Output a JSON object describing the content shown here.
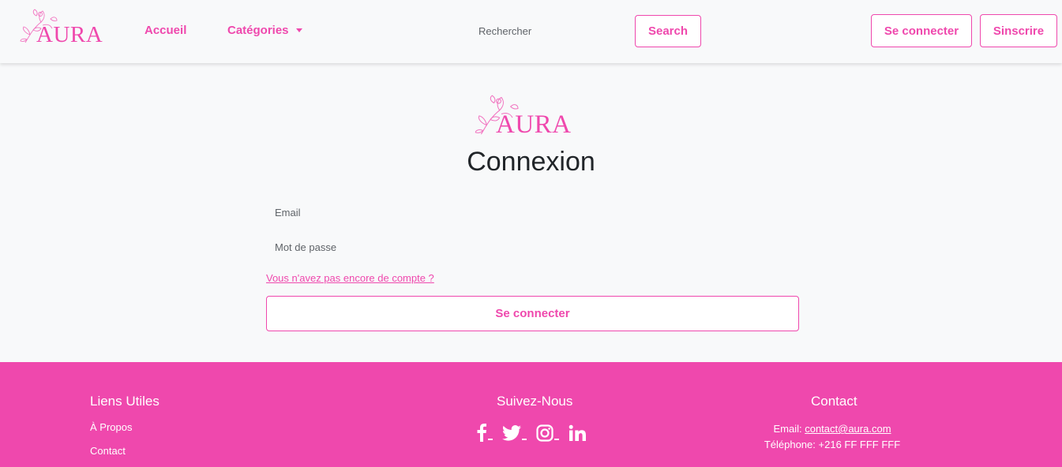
{
  "brand": {
    "name": "AURA",
    "color": "#ef48ad"
  },
  "nav": {
    "home_label": "Accueil",
    "categories_label": "Catégories",
    "search_placeholder": "Rechercher",
    "search_button": "Search",
    "login_button": "Se connecter",
    "signup_button": "Sinscrire"
  },
  "login": {
    "title": "Connexion",
    "email_placeholder": "Email",
    "password_placeholder": "Mot de passe",
    "register_link": "Vous n'avez pas encore de compte ?",
    "submit_button": "Se connecter"
  },
  "footer": {
    "useful_links": {
      "heading": "Liens Utiles",
      "items": [
        "À Propos",
        "Contact"
      ]
    },
    "follow": {
      "heading": "Suivez-Nous",
      "icons": [
        "facebook-icon",
        "twitter-icon",
        "instagram-icon",
        "linkedin-icon"
      ]
    },
    "contact": {
      "heading": "Contact",
      "email_label": "Email:",
      "email": "contact@aura.com",
      "phone_label": "Téléphone:",
      "phone": "+216 FF FFF FFF"
    }
  }
}
